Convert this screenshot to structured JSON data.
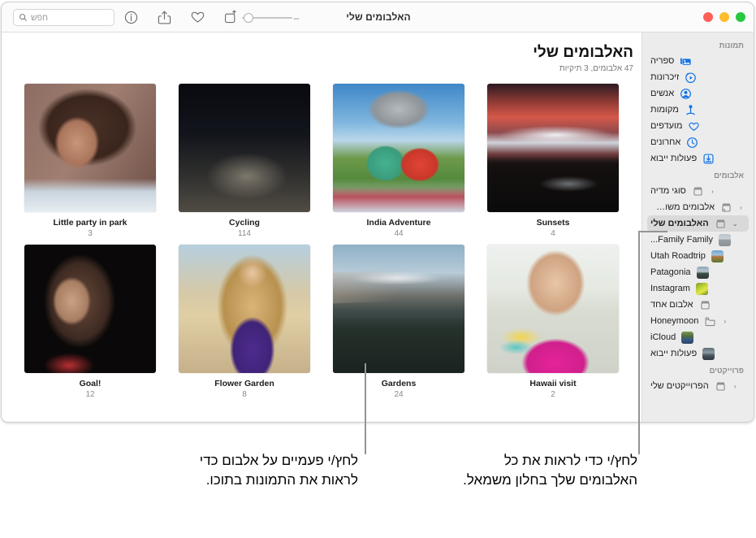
{
  "window": {
    "title": "האלבומים שלי",
    "traffic_lights": [
      "close",
      "minimize",
      "zoom"
    ]
  },
  "toolbar": {
    "search_placeholder": "חפש",
    "search_icon": "search-icon",
    "buttons": [
      {
        "name": "new-album-icon",
        "label": "אלבום חדש"
      },
      {
        "name": "favorite-heart-icon",
        "label": "מועדפים"
      },
      {
        "name": "share-icon",
        "label": "שיתוף"
      },
      {
        "name": "info-icon",
        "label": "מידע"
      }
    ],
    "zoom": {
      "plus": "+",
      "minus": "–",
      "value": 18
    }
  },
  "sidebar": {
    "sections": [
      {
        "header": "תמונות",
        "items": [
          {
            "label": "ספריה",
            "icon": "library-icon",
            "icon_color": "#1273e6",
            "chevron": "",
            "selected": false
          },
          {
            "label": "זיכרונות",
            "icon": "memories-icon",
            "icon_color": "#1273e6",
            "chevron": "",
            "selected": false
          },
          {
            "label": "אנשים",
            "icon": "people-icon",
            "icon_color": "#1273e6",
            "chevron": "",
            "selected": false
          },
          {
            "label": "מקומות",
            "icon": "places-pin-icon",
            "icon_color": "#1273e6",
            "chevron": "",
            "selected": false
          },
          {
            "label": "מועדפים",
            "icon": "heart-icon",
            "icon_color": "#1273e6",
            "chevron": "",
            "selected": false
          },
          {
            "label": "אחרונים",
            "icon": "clock-icon",
            "icon_color": "#1273e6",
            "chevron": "",
            "selected": false
          },
          {
            "label": "פעולות ייבוא",
            "icon": "import-icon",
            "icon_color": "#1273e6",
            "chevron": "",
            "selected": false
          }
        ]
      },
      {
        "header": "אלבומים",
        "items": [
          {
            "label": "סוגי מדיה",
            "icon": "album-icon",
            "icon_color": "#8a8a8a",
            "chevron": "‹",
            "selected": false
          },
          {
            "label": "אלבומים משותפים",
            "icon": "shared-album-icon",
            "icon_color": "#8a8a8a",
            "chevron": "‹",
            "selected": false
          },
          {
            "label": "האלבומים שלי",
            "icon": "album-icon",
            "icon_color": "#8a8a8a",
            "chevron": "⌄",
            "selected": true
          },
          {
            "label": "Family Family...",
            "icon": "album-thumbnail",
            "thumb": "family",
            "chevron": "",
            "selected": false
          },
          {
            "label": "Utah Roadtrip",
            "icon": "album-thumbnail",
            "thumb": "utah",
            "chevron": "",
            "selected": false
          },
          {
            "label": "Patagonia",
            "icon": "album-thumbnail",
            "thumb": "patagonia",
            "chevron": "",
            "selected": false
          },
          {
            "label": "Instagram",
            "icon": "album-thumbnail",
            "thumb": "instagram",
            "chevron": "",
            "selected": false
          },
          {
            "label": "אלבום אחד",
            "icon": "album-icon",
            "icon_color": "#8a8a8a",
            "chevron": "",
            "selected": false
          },
          {
            "label": "Honeymoon",
            "icon": "folder-icon",
            "icon_color": "#8a8a8a",
            "chevron": "‹",
            "selected": false
          },
          {
            "label": "iCloud",
            "icon": "album-thumbnail",
            "thumb": "icloud",
            "chevron": "",
            "selected": false
          },
          {
            "label": "פעולות ייבוא",
            "icon": "album-thumbnail",
            "thumb": "import",
            "chevron": "",
            "selected": false
          }
        ]
      },
      {
        "header": "פרוייקטים",
        "items": [
          {
            "label": "הפרוייקטים שלי",
            "icon": "album-icon",
            "icon_color": "#8a8a8a",
            "chevron": "‹",
            "selected": false
          }
        ]
      }
    ]
  },
  "main": {
    "title": "האלבומים שלי",
    "subtitle": "47 אלבומים, 3 תיקיות",
    "albums": [
      {
        "name": "Little party in park",
        "count": "3",
        "art": "portrait-curly"
      },
      {
        "name": "Cycling",
        "count": "114",
        "art": "night-cyclists"
      },
      {
        "name": "India Adventure",
        "count": "44",
        "art": "kids-picnic"
      },
      {
        "name": "Sunsets",
        "count": "4",
        "art": "red-sunset"
      },
      {
        "name": "Goal!",
        "count": "12",
        "art": "dark-portrait"
      },
      {
        "name": "Flower Garden",
        "count": "8",
        "art": "blonde-rooftop"
      },
      {
        "name": "Gardens",
        "count": "24",
        "art": "patagonia-lake"
      },
      {
        "name": "Hawaii visit",
        "count": "2",
        "art": "girl-pink"
      }
    ]
  },
  "callouts": [
    {
      "name": "callout-double-click-album",
      "text": "לחץ/י פעמיים על אלבום כדי לראות את התמונות בתוכו."
    },
    {
      "name": "callout-sidebar-albums",
      "text": "לחץ/י כדי לראות את כל האלבומים שלך בחלון משמאל."
    }
  ],
  "colors": {
    "accent": "#1273e6",
    "sidebar_bg": "#ececec",
    "selected_row": "#d9d9d9",
    "leader_line": "#949494"
  }
}
